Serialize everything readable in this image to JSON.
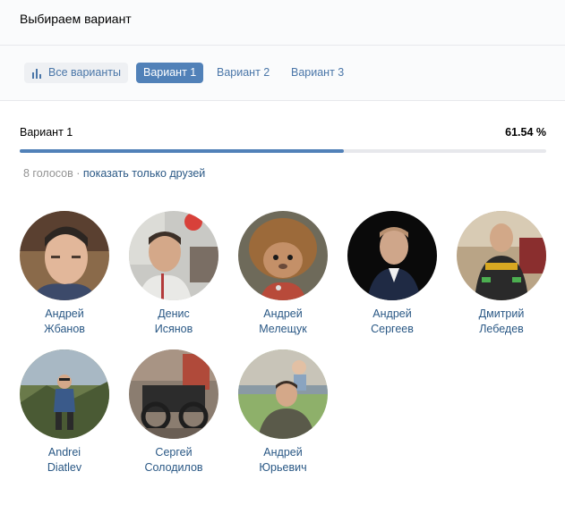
{
  "header": {
    "title": "Выбираем вариант"
  },
  "tabs": {
    "all_label": "Все варианты",
    "v1_label": "Вариант 1",
    "v2_label": "Вариант 2",
    "v3_label": "Вариант 3",
    "all_icon": "bar-chart-icon"
  },
  "variant": {
    "name": "Вариант 1",
    "percent_label": "61.54 %",
    "percent": 61.54
  },
  "votes": {
    "count_label": "8 голосов",
    "separator": " · ",
    "friends_link": "показать только друзей"
  },
  "voters": [
    {
      "first": "Андрей",
      "last": "Жбанов"
    },
    {
      "first": "Денис",
      "last": "Исянов"
    },
    {
      "first": "Андрей",
      "last": "Мелещук"
    },
    {
      "first": "Андрей",
      "last": "Сергеев"
    },
    {
      "first": "Дмитрий",
      "last": "Лебедев"
    },
    {
      "first": "Andrei",
      "last": "Diatlev"
    },
    {
      "first": "Сергей",
      "last": "Солодилов"
    },
    {
      "first": "Андрей",
      "last": "Юрьевич"
    }
  ],
  "colors": {
    "accent": "#5181b8",
    "link": "#2a5885",
    "muted": "#939393"
  }
}
